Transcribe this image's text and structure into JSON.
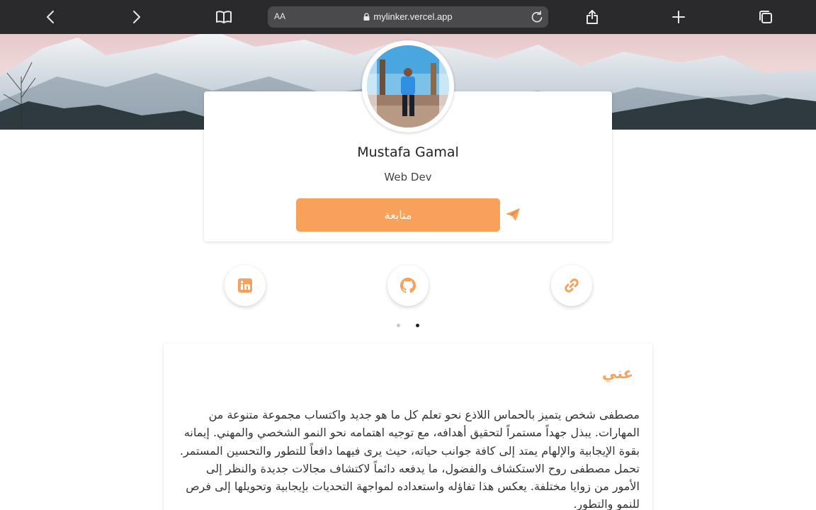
{
  "browser": {
    "aa_label": "AA",
    "url": "mylinker.vercel.app"
  },
  "profile": {
    "name": "Mustafa Gamal",
    "role": "Web Dev",
    "follow_label": "متابعة"
  },
  "social": [
    "linkedin-icon",
    "github-icon",
    "link-icon"
  ],
  "pager": {
    "dots": 2,
    "active": 2
  },
  "about": {
    "title": "عني",
    "text": "مصطفى شخص يتميز بالحماس اللاذع نحو تعلم كل ما هو جديد واكتساب مجموعة متنوعة من المهارات. يبذل جهداً مستمراً لتحقيق أهدافه، مع توجيه اهتمامه نحو النمو الشخصي والمهني. إيمانه بقوة الإيجابية والإلهام يمتد إلى كافة جوانب حياته، حيث يرى فيهما دافعاً للتطور والتحسين المستمر. تحمل مصطفى روح الاستكشاف والفضول، ما يدفعه دائماً لاكتشاف مجالات جديدة والنظر إلى الأمور من زوايا مختلفة. يعكس هذا تفاؤله واستعداده لمواجهة التحديات بإيجابية وتحويلها إلى فرص للنمو والتطور."
  },
  "colors": {
    "accent": "#f7a15a",
    "toolbar": "#2a2a2c"
  }
}
